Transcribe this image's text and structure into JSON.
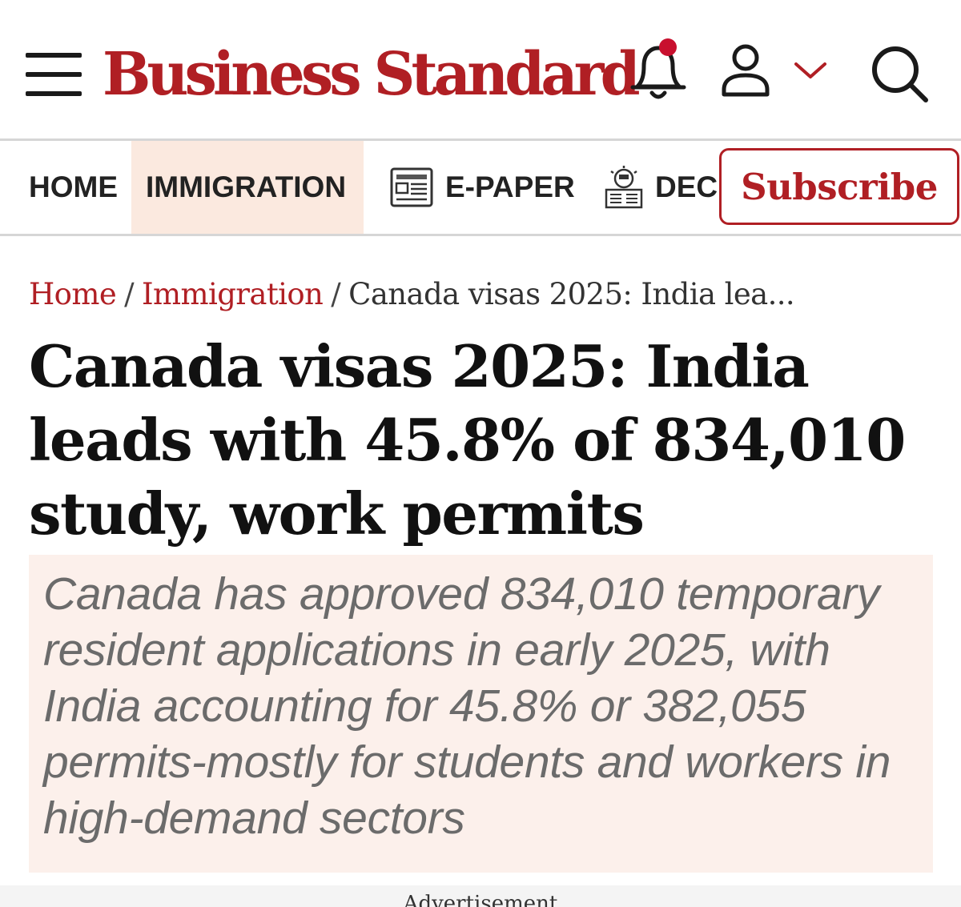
{
  "header": {
    "logo_text": "Business Standard",
    "brand_color": "#b01f24",
    "icons": {
      "menu": "hamburger-menu-icon",
      "notifications": "bell-icon",
      "notification_dot_color": "#c8102e",
      "account": "user-icon",
      "account_dropdown": "chevron-down-icon",
      "search": "search-icon"
    }
  },
  "nav": {
    "items": [
      {
        "label": "HOME",
        "active": false
      },
      {
        "label": "IMMIGRATION",
        "active": true
      },
      {
        "label": "E-PAPER",
        "icon": "newspaper-icon"
      },
      {
        "label": "DEC",
        "icon": "lightbulb-icon"
      }
    ],
    "active_bg_color": "#fbe9df",
    "subscribe_label": "Subscribe"
  },
  "breadcrumb": {
    "items": [
      {
        "label": "Home"
      },
      {
        "label": "Immigration"
      }
    ],
    "separator": "/",
    "current": "Canada visas 2025: India lea..."
  },
  "article": {
    "headline": "Canada visas 2025: India leads with 45.8% of 834,010 study, work permits",
    "summary": "Canada has approved 834,010 temporary resident applications in early 2025, with India accounting for 45.8% or 382,055 permits-mostly for students and workers in high-demand sectors",
    "summary_bg_color": "#fcf0eb"
  },
  "advertisement": {
    "label": "Advertisement"
  }
}
